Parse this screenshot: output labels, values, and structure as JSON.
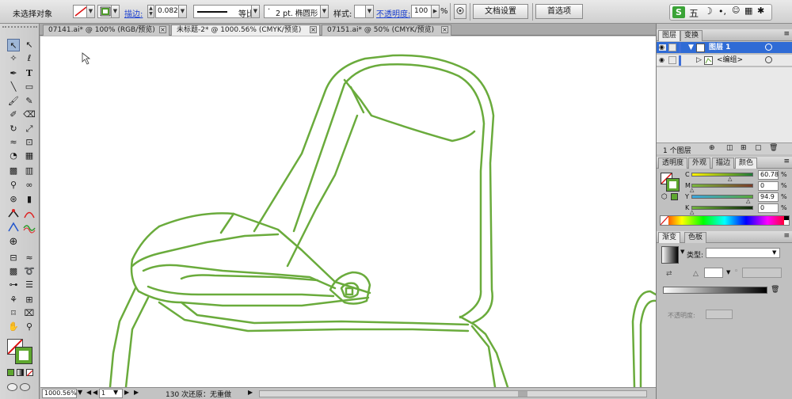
{
  "control_bar": {
    "selection_status": "未选择对象",
    "stroke_label": "描边:",
    "stroke_weight": "0.082",
    "profile_label": "等比",
    "brush_label": "2 pt. 椭圆形",
    "style_label": "样式:",
    "opacity_label": "不透明度:",
    "opacity_value": "100",
    "percent": "%",
    "doc_setup_button": "文档设置",
    "preferences_button": "首选项"
  },
  "ime": {
    "label": "五"
  },
  "doc_tabs": [
    {
      "label": "07141.ai* @ 100% (RGB/预览)"
    },
    {
      "label": "未标题-2* @ 1000.56% (CMYK/预览)"
    },
    {
      "label": "07151.ai* @ 50% (CMYK/预览)"
    }
  ],
  "close_glyph": "×",
  "tools": {
    "selection": "↖",
    "direct_selection": "↖",
    "magic_wand": "✧",
    "lasso": "ℓ",
    "pen": "✒",
    "type": "T",
    "line": "╲",
    "rectangle": "▭",
    "paintbrush": "🖌",
    "pencil": "✎",
    "blob": "✐",
    "eraser": "⌫",
    "rotate": "↻",
    "scale": "⤢",
    "warp": "≈",
    "free_transform": "⊡",
    "shape_builder": "◔",
    "perspective": "▦",
    "mesh": "▩",
    "gradient": "▥",
    "eyedropper": "⚲",
    "blend": "∞",
    "symbol": "⊛",
    "graph": "▮",
    "artboard": "⊟",
    "slice": "⌧",
    "hand": "✋",
    "zoom": "⚲"
  },
  "status_bar": {
    "zoom": "1000.56%",
    "page": "1",
    "history": "130 次还原：无重做"
  },
  "layers_panel": {
    "tabs": [
      "图层",
      "变换"
    ],
    "rows": [
      {
        "name": "图层 1"
      },
      {
        "name": "<编组>"
      }
    ],
    "footer": "1 个图层"
  },
  "color_panel": {
    "tabs": [
      "透明度",
      "外观",
      "描边",
      "颜色"
    ],
    "channels": [
      {
        "name": "C",
        "value": "60.78"
      },
      {
        "name": "M",
        "value": "0"
      },
      {
        "name": "Y",
        "value": "94.9"
      },
      {
        "name": "K",
        "value": "0"
      }
    ],
    "pct": "%"
  },
  "gradient_panel": {
    "tabs": [
      "渐变",
      "色板"
    ],
    "type_label": "类型:",
    "opacity_label": "不透明度:"
  },
  "colors": {
    "stroke": "#6aab3c",
    "selection_blue": "#2f6bd5"
  }
}
